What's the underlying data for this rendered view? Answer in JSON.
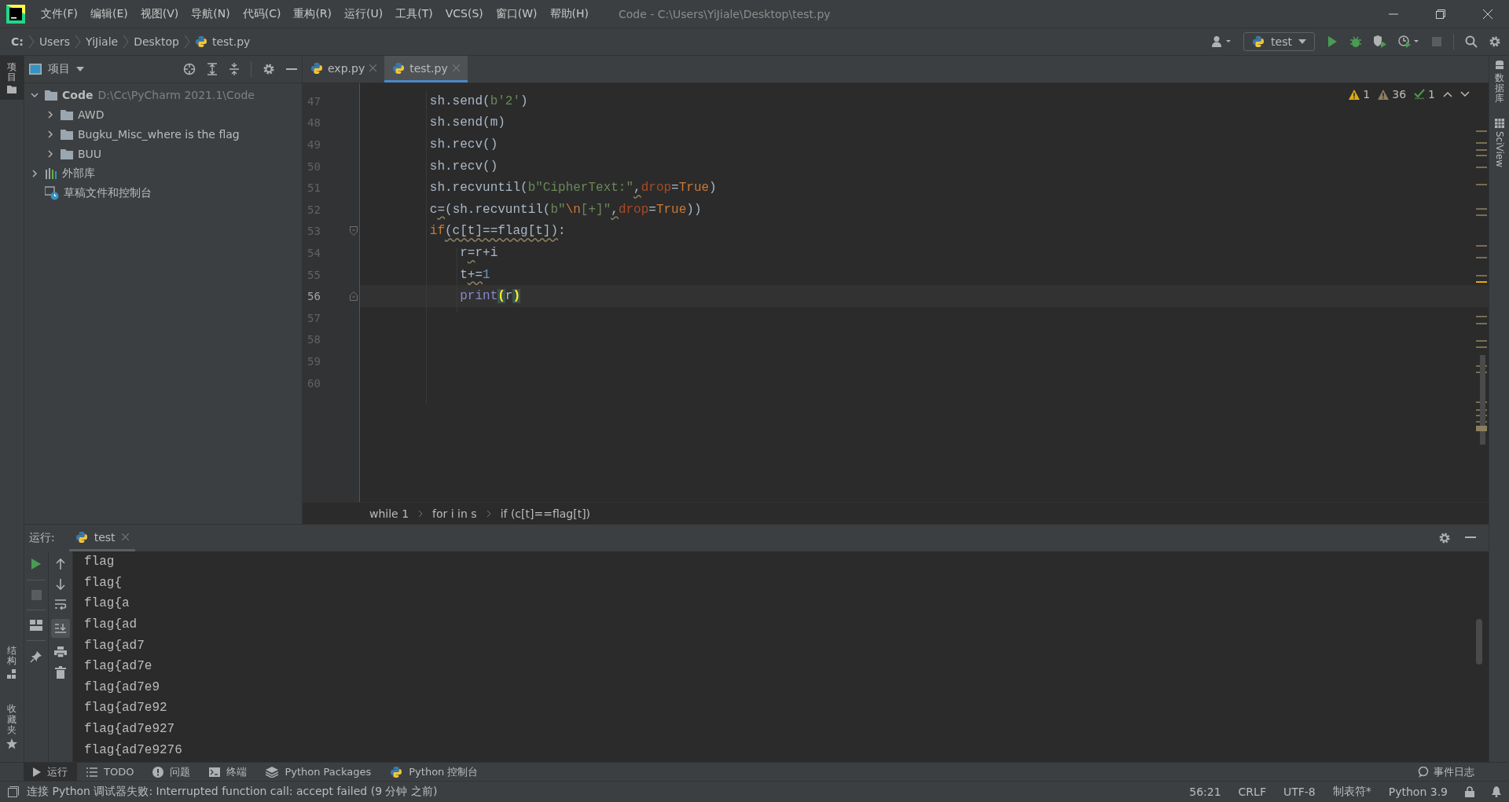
{
  "menu": [
    "文件(F)",
    "编辑(E)",
    "视图(V)",
    "导航(N)",
    "代码(C)",
    "重构(R)",
    "运行(U)",
    "工具(T)",
    "VCS(S)",
    "窗口(W)",
    "帮助(H)"
  ],
  "window_title": "Code - C:\\Users\\YiJiale\\Desktop\\test.py",
  "nav_path": [
    {
      "label": "C:",
      "kind": "drive"
    },
    {
      "label": "Users",
      "kind": "folder"
    },
    {
      "label": "YiJiale",
      "kind": "folder"
    },
    {
      "label": "Desktop",
      "kind": "folder"
    },
    {
      "label": "test.py",
      "kind": "file"
    }
  ],
  "run_config": "test",
  "left_strip_top": [
    {
      "label": "项目",
      "selected": true
    }
  ],
  "left_strip_bottom": [
    {
      "label": "结构",
      "kind": "structure",
      "selected": false
    },
    {
      "label": "收藏夹",
      "kind": "favorites",
      "selected": false
    }
  ],
  "right_strip": [
    {
      "label": "数据库",
      "kind": "database"
    },
    {
      "label": "SciView",
      "kind": "sciview"
    }
  ],
  "project_panel": {
    "title": "项目",
    "tree": [
      {
        "label": "Code",
        "path": "D:\\Cc\\PyCharm 2021.1\\Code",
        "kind": "folder",
        "expanded": true,
        "children": [
          {
            "label": "AWD",
            "kind": "folder",
            "expanded": false
          },
          {
            "label": "Bugku_Misc_where is the flag",
            "kind": "folder",
            "expanded": false
          },
          {
            "label": "BUU",
            "kind": "folder",
            "expanded": false
          }
        ]
      },
      {
        "label": "外部库",
        "kind": "library",
        "expanded": false
      },
      {
        "label": "草稿文件和控制台",
        "kind": "scratch"
      }
    ]
  },
  "editor": {
    "tabs": [
      {
        "label": "exp.py",
        "selected": false
      },
      {
        "label": "test.py",
        "selected": true
      }
    ],
    "inspections": [
      {
        "kind": "warning",
        "count": "1"
      },
      {
        "kind": "weak",
        "count": "36"
      },
      {
        "kind": "typo",
        "count": "1"
      }
    ],
    "lines": [
      {
        "number": "47",
        "tokens": [
          {
            "kind": "plain",
            "text": "        sh.send("
          },
          {
            "kind": "string",
            "text": "b'2'"
          },
          {
            "kind": "plain",
            "text": ")"
          }
        ]
      },
      {
        "number": "48",
        "tokens": [
          {
            "kind": "plain",
            "text": "        sh.send(m)"
          }
        ]
      },
      {
        "number": "49",
        "tokens": [
          {
            "kind": "plain",
            "text": "        sh.recv()"
          }
        ]
      },
      {
        "number": "50",
        "tokens": [
          {
            "kind": "plain",
            "text": "        sh.recv()"
          }
        ]
      },
      {
        "number": "51",
        "tokens": [
          {
            "kind": "plain",
            "text": "        sh.recvuntil("
          },
          {
            "kind": "string",
            "text": "b\"CipherText:\""
          },
          {
            "kind": "plain",
            "text": ",",
            "warn": true
          },
          {
            "kind": "param",
            "text": "drop"
          },
          {
            "kind": "plain",
            "text": "="
          },
          {
            "kind": "keyword",
            "text": "True"
          },
          {
            "kind": "plain",
            "text": ")"
          }
        ]
      },
      {
        "number": "52",
        "tokens": [
          {
            "kind": "plain",
            "text": "        c"
          },
          {
            "kind": "plain",
            "text": "=",
            "warn": true
          },
          {
            "kind": "plain",
            "text": "(sh.recvuntil("
          },
          {
            "kind": "string",
            "text": "b\""
          },
          {
            "kind": "keyword",
            "text": "\\n"
          },
          {
            "kind": "string",
            "text": "[+]\""
          },
          {
            "kind": "plain",
            "text": ",",
            "warn": true
          },
          {
            "kind": "param",
            "text": "drop"
          },
          {
            "kind": "plain",
            "text": "="
          },
          {
            "kind": "keyword",
            "text": "True"
          },
          {
            "kind": "plain",
            "text": "))"
          }
        ]
      },
      {
        "number": "53",
        "fold_start": true,
        "tokens": [
          {
            "kind": "keyword",
            "text": "        if"
          },
          {
            "kind": "plain",
            "text": "(c[t]==flag[t])",
            "warn": true
          },
          {
            "kind": "plain",
            "text": ":"
          }
        ]
      },
      {
        "number": "54",
        "tokens": [
          {
            "kind": "plain",
            "text": "            r"
          },
          {
            "kind": "plain",
            "text": "=",
            "warn": true
          },
          {
            "kind": "plain",
            "text": "r+i"
          }
        ]
      },
      {
        "number": "55",
        "tokens": [
          {
            "kind": "plain",
            "text": "            t"
          },
          {
            "kind": "plain",
            "text": "+=",
            "warn": true
          },
          {
            "kind": "number",
            "text": "1"
          }
        ]
      },
      {
        "number": "56",
        "fold_end": true,
        "current": true,
        "tokens": [
          {
            "kind": "builtin",
            "text": "            print"
          },
          {
            "kind": "match",
            "text": "("
          },
          {
            "kind": "plain",
            "text": "r"
          },
          {
            "kind": "match",
            "text": ")"
          }
        ]
      },
      {
        "number": "57"
      },
      {
        "number": "58"
      },
      {
        "number": "59"
      },
      {
        "number": "60"
      }
    ],
    "breadcrumbs": [
      "while 1",
      "for i in s",
      "if (c[t]==flag[t])"
    ]
  },
  "run_panel": {
    "label": "运行:",
    "tab": "test",
    "scroll_to_end": true,
    "output": [
      "flag",
      "flag{",
      "flag{a",
      "flag{ad",
      "flag{ad7",
      "flag{ad7e",
      "flag{ad7e9",
      "flag{ad7e92",
      "flag{ad7e927",
      "flag{ad7e9276"
    ]
  },
  "tool_tabs": [
    {
      "label": "运行",
      "kind": "run",
      "selected": true
    },
    {
      "label": "TODO",
      "kind": "todo",
      "selected": false
    },
    {
      "label": "问题",
      "kind": "problems",
      "selected": false
    },
    {
      "label": "终端",
      "kind": "terminal",
      "selected": false
    },
    {
      "label": "Python Packages",
      "kind": "packages",
      "selected": false
    },
    {
      "label": "Python 控制台",
      "kind": "console",
      "selected": false
    }
  ],
  "event_log": "事件日志",
  "status": {
    "message": "连接 Python 调试器失败: Interrupted function call: accept failed (9 分钟 之前)",
    "items": [
      "56:21",
      "CRLF",
      "UTF-8",
      "制表符*",
      "Python 3.9"
    ]
  }
}
